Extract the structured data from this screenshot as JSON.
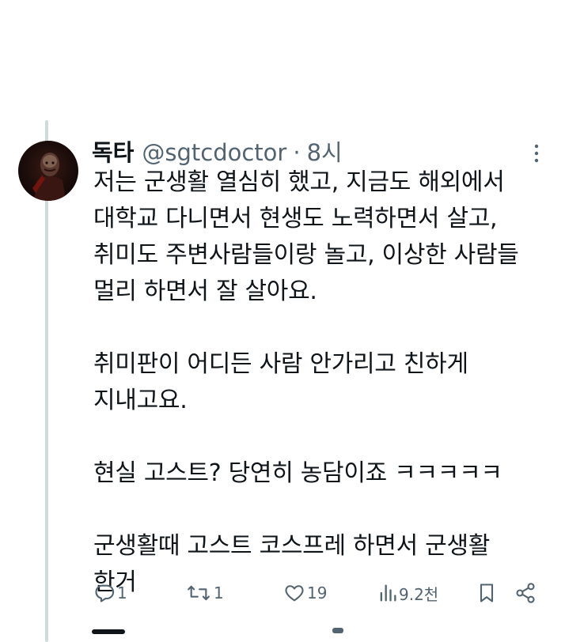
{
  "tweet": {
    "display_name": "독타",
    "handle": "@sgtcdoctor",
    "separator": "·",
    "time": "8시",
    "lines": [
      "저는 군생활 열심히 했고, 지금도 해외에서",
      "대학교 다니면서 현생도 노력하면서 살고,",
      "취미도 주변사람들이랑 놀고, 이상한 사람들",
      "멀리 하면서 잘 살아요.",
      "",
      "취미판이 어디든 사람 안가리고 친하게",
      "지내고요.",
      "",
      "현실 고스트? 당연히 농담이죠 ㅋㅋㅋㅋㅋ",
      "",
      "군생활때 고스트 코스프레 하면서 군생활",
      "한거"
    ]
  },
  "actions": {
    "reply_count": "1",
    "retweet_count": "1",
    "like_count": "19",
    "views_count": "9.2천"
  },
  "icons": {
    "more": "more-vertical-icon",
    "reply": "reply-icon",
    "retweet": "retweet-icon",
    "like": "heart-icon",
    "views": "views-icon",
    "bookmark": "bookmark-icon",
    "share": "share-icon"
  },
  "colors": {
    "text": "#0f1419",
    "secondary": "#536471",
    "thread_line": "#cfd9de"
  }
}
